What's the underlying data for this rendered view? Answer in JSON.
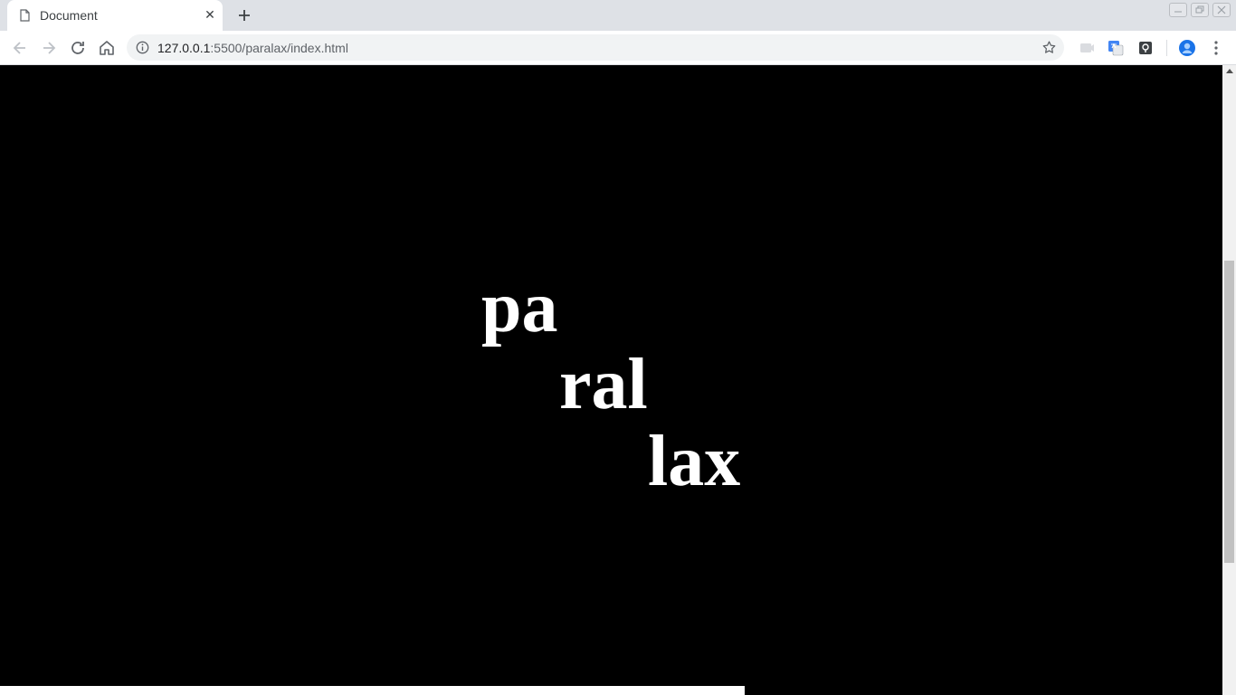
{
  "browser": {
    "tab": {
      "title": "Document"
    },
    "address_bar": {
      "host": "127.0.0.1",
      "rest": ":5500/paralax/index.html"
    }
  },
  "page": {
    "words": [
      "pa",
      "ral",
      "lax"
    ],
    "background": "#000000",
    "text_color": "#ffffff"
  }
}
